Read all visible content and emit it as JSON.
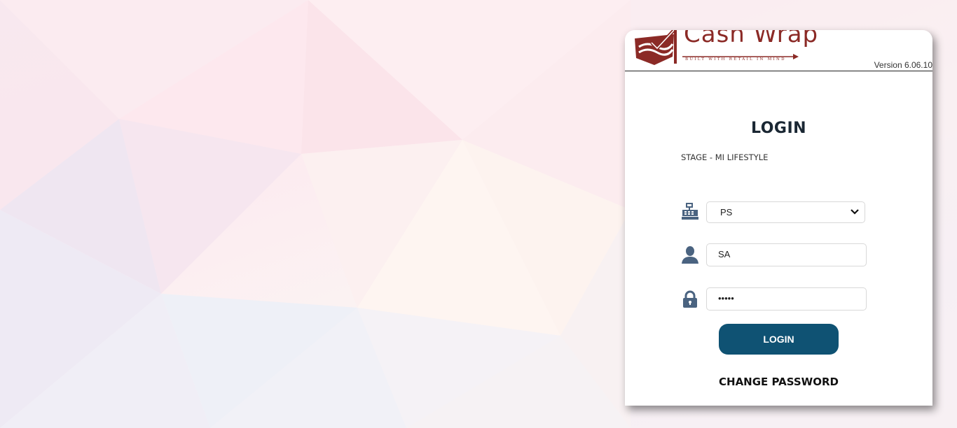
{
  "header": {
    "logo_text": "Cash Wrap",
    "logo_tagline": "BUILT WITH RETAIL IN MIND",
    "version": "Version 6.06.10"
  },
  "login": {
    "title": "LOGIN",
    "environment": "STAGE - MI LIFESTYLE",
    "register_select": {
      "value": "PS",
      "icon": "cash-register-icon"
    },
    "username": {
      "value": "SA",
      "icon": "user-icon"
    },
    "password": {
      "value": "•••••",
      "icon": "lock-icon"
    },
    "submit_label": "LOGIN",
    "change_password_label": "CHANGE PASSWORD"
  },
  "colors": {
    "brand": "#8b2a26",
    "button": "#0f5273",
    "icon": "#4a6380"
  }
}
